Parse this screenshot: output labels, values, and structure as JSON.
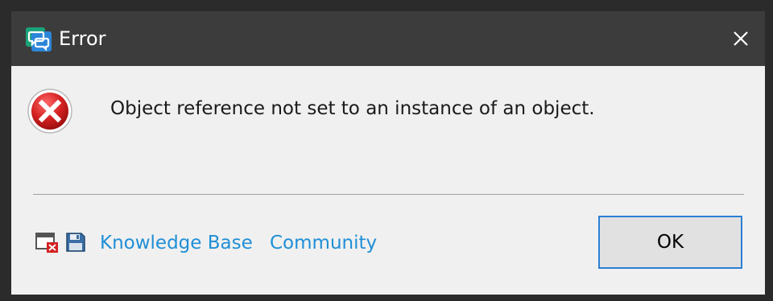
{
  "window": {
    "title": "Error",
    "close_label": "close"
  },
  "dialog": {
    "message": "Object reference not set to an instance of an object.",
    "icon": "error-icon"
  },
  "footer": {
    "icons": [
      "window-error-icon",
      "save-icon"
    ],
    "links": [
      {
        "label": "Knowledge Base"
      },
      {
        "label": "Community"
      }
    ],
    "ok_label": "OK"
  },
  "colors": {
    "titlebar": "#3c3c3c",
    "body": "#f0f0f0",
    "link": "#1f8fd6",
    "error_red": "#d42020",
    "button_border": "#2b7fd6"
  }
}
